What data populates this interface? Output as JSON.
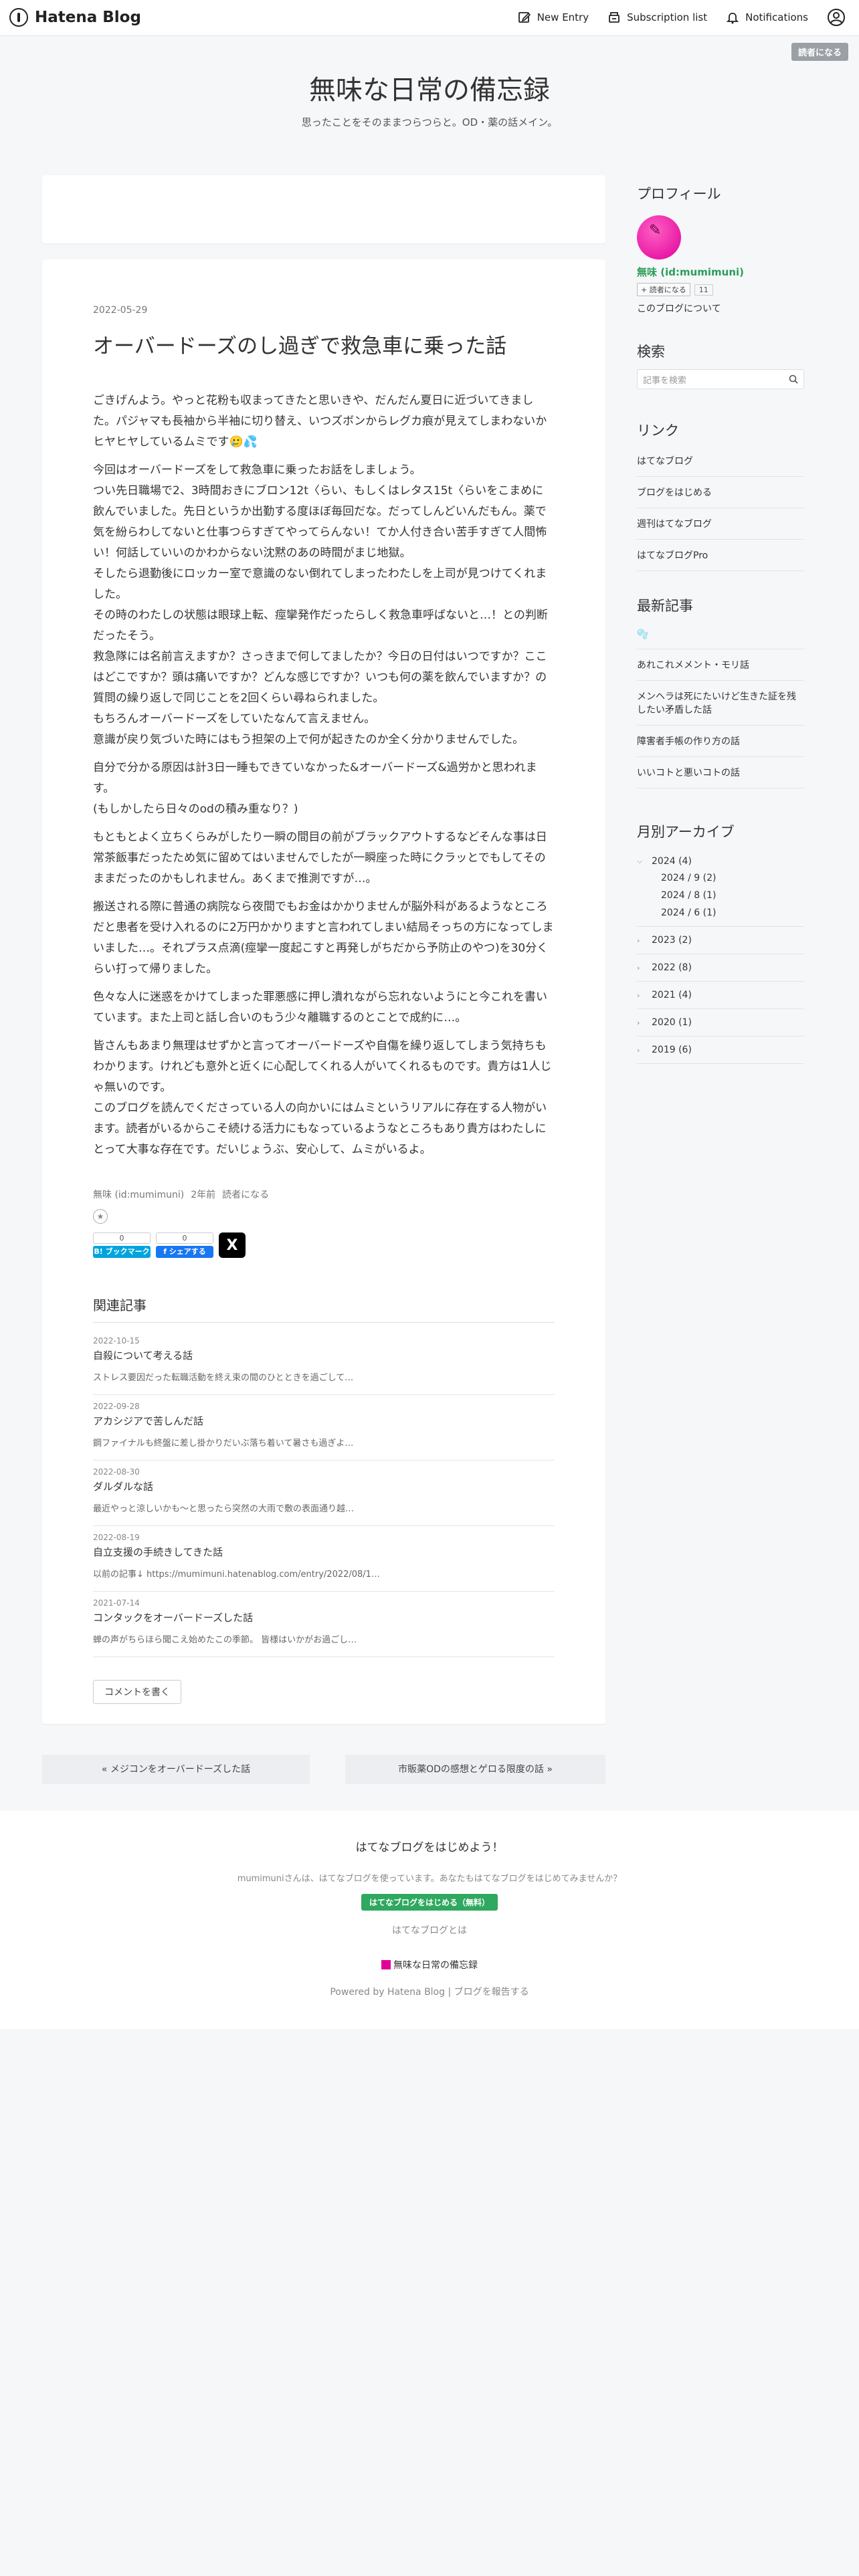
{
  "topbar": {
    "logo": "Hatena Blog",
    "nav": [
      "New Entry",
      "Subscription list",
      "Notifications"
    ],
    "reader_button": "読者になる"
  },
  "header": {
    "title": "無味な日常の備忘録",
    "description": "思ったことをそのままつらつらと。OD・薬の話メイン。"
  },
  "article": {
    "date": "2022-05-29",
    "title": "オーバードーズのし過ぎで救急車に乗った話",
    "paragraphs": [
      "ごきげんよう。やっと花粉も収まってきたと思いきや、だんだん夏日に近づいてきました。パジャマも長袖から半袖に切り替え、いつズボンからレグカ痕が見えてしまわないかヒヤヒヤしているムミです🥲💦",
      "今回はオーバードーズをして救急車に乗ったお話をしましょう。\nつい先日職場で2、3時間おきにブロン12t〈らい、もしくはレタス15t〈らいをこまめに飲んでいました。先日というか出勤する度ほぼ毎回だな。だってしんどいんだもん。薬で気を紛らわしてないと仕事つらすぎてやってらんない！てか人付き合い苦手すぎて人間怖い！何話していいのかわからない沈黙のあの時間がまじ地獄。\nそしたら退勤後にロッカー室で意識のない倒れてしまったわたしを上司が見つけてくれました。\nその時のわたしの状態は眼球上転、痙攣発作だったらしく救急車呼ばないと…！との判断だったそう。\n救急隊には名前言えますか？さっきまで何してましたか？今日の日付はいつですか？ここはどこですか？頭は痛いですか？どんな感じですか？いつも何の薬を飲んでいますか？の質問の繰り返しで同じことを2回くらい尋ねられました。\nもちろんオーバードーズをしていたなんて言えません。\n意識が戻り気づいた時にはもう担架の上で何が起きたのか全く分かりませんでした。",
      "自分で分かる原因は計3日一睡もできていなかった&オーバードーズ&過労かと思われます。\n(もしかしたら日々のodの積み重なり？)",
      "もともとよく立ちくらみがしたり一瞬の間目の前がブラックアウトするなどそんな事は日常茶飯事だったため気に留めてはいませんでしたが一瞬座った時にクラッとでもしてそのままだったのかもしれません。あくまで推測ですが…。",
      "搬送される際に普通の病院なら夜間でもお金はかかりませんが脳外科があるようなところだと患者を受け入れるのに2万円かかりますと言われてしまい結局そっちの方になってしまいました…。それプラス点滴(痙攣一度起こすと再発しがちだから予防止のやつ)を30分くらい打って帰りました。",
      "色々な人に迷惑をかけてしまった罪悪感に押し潰れながら忘れないようにと今これを書いています。また上司と話し合いのもう少々離職するのとことで成約に…。",
      "皆さんもあまり無理はせずかと言ってオーバードーズや自傷を繰り返してしまう気持ちもわかります。けれども意外と近くに心配してくれる人がいてくれるものです。貴方は1人じゃ無いのです。\nこのブログを読んでくださっている人の向かいにはムミというリアルに存在する人物がいます。読者がいるからこそ続ける活力にもなっているようなところもあり貴方はわたしにとって大事な存在です。だいじょうぶ、安心して、ムミがいるよ。"
    ],
    "meta": {
      "author": "無味 (id:mumimuni)",
      "ago": "2年前",
      "reader": "読者になる"
    },
    "share": {
      "hatena_count": "0",
      "hatena_label": "B! ブックマーク",
      "fb_count": "0",
      "fb_label": "f シェアする",
      "x_label": "X"
    },
    "related_title": "関連記事",
    "related": [
      {
        "date": "2022-10-15",
        "title": "自殺について考える話",
        "snippet": "ストレス要因だった転職活動を終え束の間のひとときを過ごして…"
      },
      {
        "date": "2022-09-28",
        "title": "アカシジアで苦しんだ話",
        "snippet": "鋼ファイナルも終盤に差し掛かりだいぶ落ち着いて暑さも過ぎよ…"
      },
      {
        "date": "2022-08-30",
        "title": "ダルダルな話",
        "snippet": "最近やっと涼しいかも〜と思ったら突然の大雨で敷の表面通り越…"
      },
      {
        "date": "2022-08-19",
        "title": "自立支援の手続きしてきた話",
        "snippet": "以前の記事↓ https://mumimuni.hatenablog.com/entry/2022/08/1…"
      },
      {
        "date": "2021-07-14",
        "title": "コンタックをオーバードーズした話",
        "snippet": "蝉の声がちらほら聞こえ始めたこの季節。 皆様はいかがお過ごし…"
      }
    ],
    "comment_button": "コメントを書く"
  },
  "pager": {
    "prev": "« メジコンをオーバードーズした話",
    "next": "市販薬ODの感想とゲロる限度の話 »"
  },
  "sidebar": {
    "profile_head": "プロフィール",
    "user": "無味 (id:mumimuni)",
    "reader_btn": "+ 読者になる",
    "reader_count": "11",
    "about": "このブログについて",
    "search_head": "検索",
    "search_placeholder": "記事を検索",
    "links_head": "リンク",
    "links": [
      "はてなブログ",
      "ブログをはじめる",
      "週刊はてなブログ",
      "はてなブログPro"
    ],
    "recent_head": "最新記事",
    "recent": [
      "🫧",
      "あれこれメメント・モリ話",
      "メンヘラは死にたいけど生きた証を残したい矛盾した話",
      "障害者手帳の作り方の話",
      "いいコトと悪いコトの話"
    ],
    "archive_head": "月別アーカイブ",
    "archive": [
      {
        "label": "2024 (4)",
        "open": true,
        "months": [
          "2024 / 9 (2)",
          "2024 / 8 (1)",
          "2024 / 6 (1)"
        ]
      },
      {
        "label": "2023 (2)",
        "open": false
      },
      {
        "label": "2022 (8)",
        "open": false
      },
      {
        "label": "2021 (4)",
        "open": false
      },
      {
        "label": "2020 (1)",
        "open": false
      },
      {
        "label": "2019 (6)",
        "open": false
      }
    ]
  },
  "footer": {
    "head": "はてなブログをはじめよう！",
    "sub": "mumimuniさんは、はてなブログを使っています。あなたもはてなブログをはじめてみませんか？",
    "button": "はてなブログをはじめる（無料）",
    "link": "はてなブログとは",
    "blog": "無味な日常の備忘録",
    "powered": "Powered by Hatena Blog | ブログを報告する"
  },
  "colors": {
    "accent_green": "#2fa860",
    "avatar_pink": "#e0009a",
    "hatena_blue": "#00a4de"
  }
}
